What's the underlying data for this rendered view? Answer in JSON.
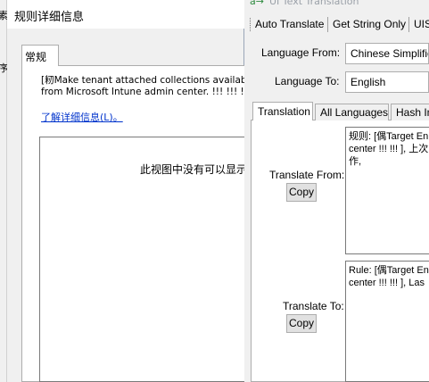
{
  "left_strip": {
    "glyph_top": "素",
    "glyph_mid": "序"
  },
  "dialog": {
    "title": "规则详细信息",
    "tab": "常规",
    "description": "[籾Make tenant attached collections available to\nfrom Microsoft Intune admin center. !!! !!! !!! ]",
    "learn_more_link": "了解详细信息(L)。",
    "empty_message": "此视图中没有可以显示"
  },
  "translator": {
    "window_title": "UI Text Translation",
    "toolbar": {
      "auto_translate": "Auto Translate",
      "get_string_only": "Get String Only",
      "uis": "UIS"
    },
    "language_from_label": "Language From:",
    "language_from_value": "Chinese Simplified",
    "language_to_label": "Language To:",
    "language_to_value": "English",
    "tabs": [
      "Translation",
      "All Languages",
      "Hash In"
    ],
    "translate_from_label": "Translate From:",
    "translate_from_text": "规则: [偶Target En\ncenter !!! !!! ], 上次\n作,",
    "translate_to_label": "Translate To:",
    "translate_to_text": "Rule: [偶Target En\ncenter !!! !!! ], Las",
    "copy_label": "Copy"
  },
  "colors": {
    "link": "#0033cc",
    "window_bg": "#f0f0f0",
    "panel_bg": "#ffffff"
  }
}
